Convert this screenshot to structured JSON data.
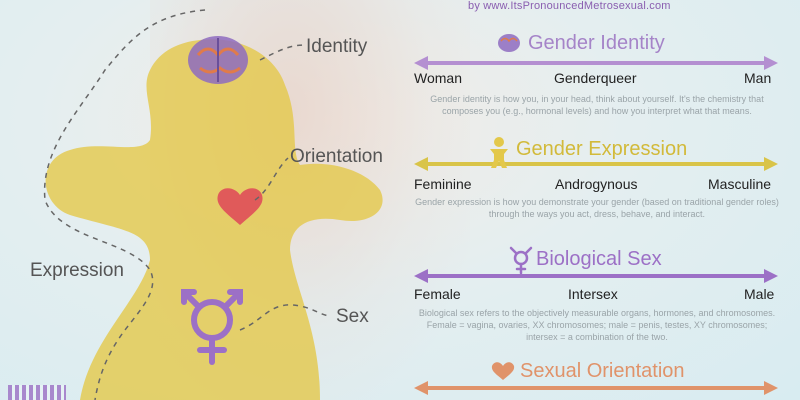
{
  "site_credit": "by www.ItsPronouncedMetrosexual.com",
  "figure_labels": {
    "identity": "Identity",
    "orientation": "Orientation",
    "expression": "Expression",
    "sex": "Sex"
  },
  "sections": [
    {
      "title": "Gender Identity",
      "icon": "brain-icon",
      "color": "#b48fd1",
      "left": "Woman",
      "middle": "Genderqueer",
      "right": "Man",
      "description": "Gender identity is how you, in your head, think about yourself.  It's the chemistry that composes you (e.g., hormonal levels) and how you interpret what that means."
    },
    {
      "title": "Gender Expression",
      "icon": "person-icon",
      "color": "#d9c448",
      "left": "Feminine",
      "middle": "Androgynous",
      "right": "Masculine",
      "description": "Gender expression is how you demonstrate your gender (based on traditional gender roles) through the ways you act, dress, behave, and interact."
    },
    {
      "title": "Biological Sex",
      "icon": "transgender-symbol-icon",
      "color": "#9c70c6",
      "left": "Female",
      "middle": "Intersex",
      "right": "Male",
      "description": "Biological sex refers to the objectively measurable organs, hormones, and chromosomes. Female = vagina, ovaries, XX chromosomes; male = penis, testes, XY chromosomes; intersex = a combination of the two."
    },
    {
      "title": "Sexual Orientation",
      "icon": "heart-icon",
      "color": "#e0936a"
    }
  ],
  "colors": {
    "background": "#d9eef2",
    "figure_yellow": "#e3c84a",
    "identity_arrow": "#b48fd1",
    "expression_arrow": "#d9c448",
    "sex_arrow": "#9c70c6",
    "orientation_arrow": "#e0936a",
    "heart": "#e05a5a"
  }
}
